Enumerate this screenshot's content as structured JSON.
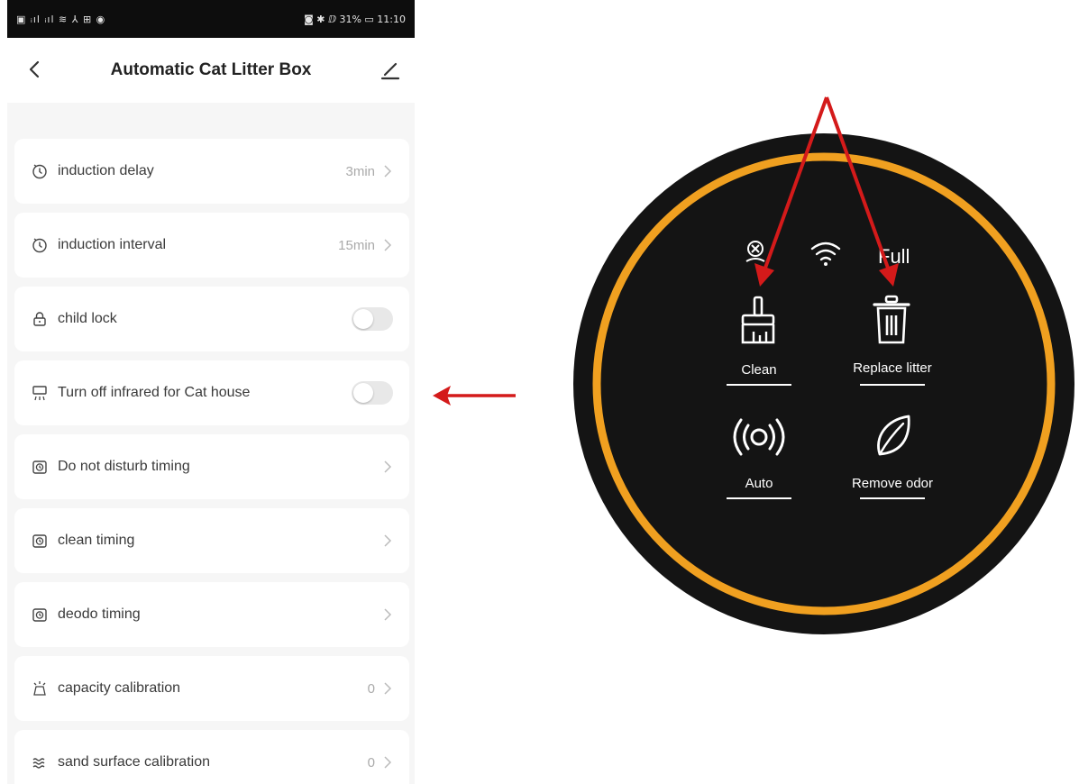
{
  "status_bar": {
    "left": "▣ ᵢıl ᵢıl ≋ ⅄ ⊞ ◉",
    "right": "◙ ✱ ⅅ 31% ▭ 11:10"
  },
  "header": {
    "title": "Automatic Cat Litter Box"
  },
  "settings": [
    {
      "label": "induction delay",
      "value": "3min",
      "control": "chevron",
      "icon": "clock-icon"
    },
    {
      "label": "induction interval",
      "value": "15min",
      "control": "chevron",
      "icon": "clock-icon"
    },
    {
      "label": "child lock",
      "control": "toggle",
      "state": "off",
      "icon": "lock-icon"
    },
    {
      "label": "Turn off infrared for Cat house",
      "control": "toggle",
      "state": "off",
      "icon": "infrared-icon"
    },
    {
      "label": "Do not disturb timing",
      "control": "chevron",
      "icon": "alarm-clock-icon"
    },
    {
      "label": "clean timing",
      "control": "chevron",
      "icon": "alarm-clock-icon"
    },
    {
      "label": "deodo timing",
      "control": "chevron",
      "icon": "alarm-clock-icon"
    },
    {
      "label": "capacity calibration",
      "value": "0",
      "control": "chevron",
      "icon": "calibration-icon"
    },
    {
      "label": "sand surface calibration",
      "value": "0",
      "control": "chevron",
      "icon": "wave-icon"
    }
  ],
  "device_panel": {
    "status_text": "Full",
    "buttons": [
      {
        "label": "Clean",
        "icon": "broom-icon"
      },
      {
        "label": "Replace litter",
        "icon": "trash-icon"
      },
      {
        "label": "Auto",
        "icon": "broadcast-icon"
      },
      {
        "label": "Remove odor",
        "icon": "leaf-icon"
      }
    ],
    "colors": {
      "ring": "#f0a020",
      "face": "#141414",
      "arrow": "#d41a1a"
    }
  }
}
